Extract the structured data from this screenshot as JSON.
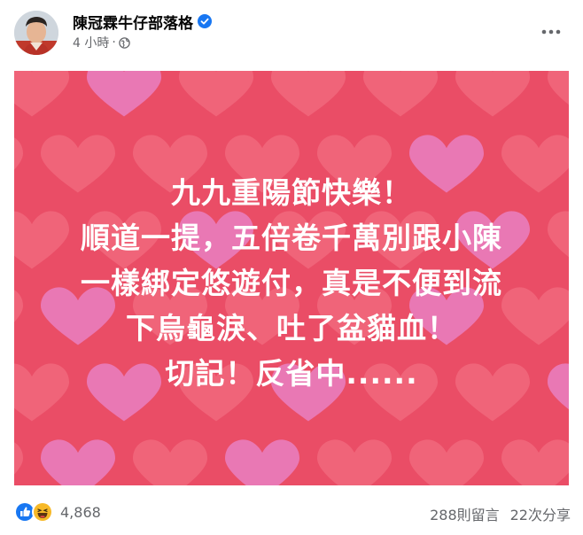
{
  "post": {
    "author": "陳冠霖牛仔部落格",
    "time": "4 小時",
    "dot": "·",
    "icons": {
      "verified": "verified-badge-icon",
      "audience": "globe-icon",
      "more": "more-options-icon"
    },
    "colors": {
      "verified": "#1877f2",
      "background": "#ea4d66",
      "heart_light": "#f16c80",
      "heart_pink": "#e97ab8"
    },
    "image_text": [
      "九九重陽節快樂！",
      "順道一提，五倍卷千萬別跟小陳",
      "一樣綁定悠遊付，真是不便到流",
      "下烏龜淚、吐了盆貓血！",
      "切記！反省中......"
    ]
  },
  "footer": {
    "reaction_icons": [
      "like-reaction-icon",
      "haha-reaction-icon"
    ],
    "reaction_count": "4,868",
    "comments": "288則留言",
    "shares": "22次分享"
  }
}
